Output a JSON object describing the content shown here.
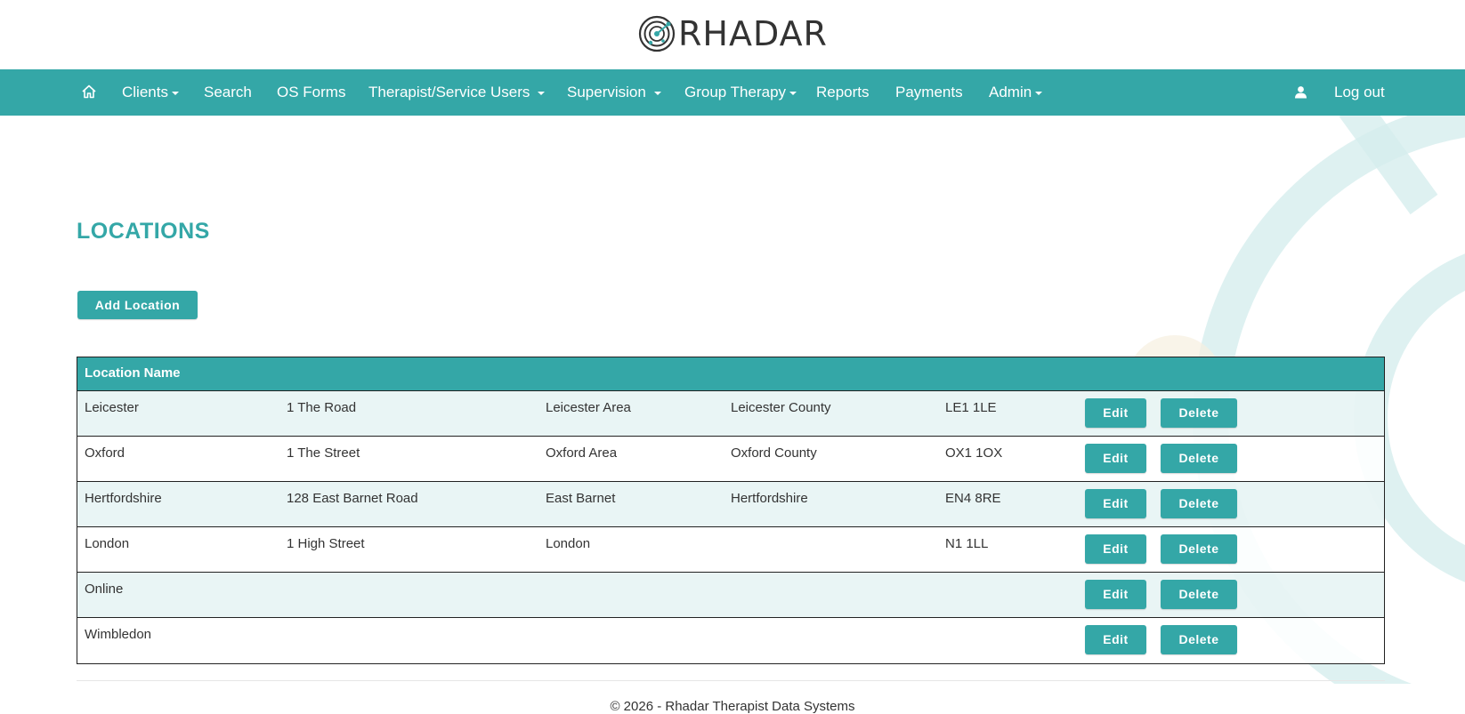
{
  "brand": {
    "name": "RHADAR",
    "logo_icon": "radar-icon"
  },
  "colors": {
    "accent": "#34a7a7",
    "row_tint": "#e7f4f4",
    "deco": "#d6eeee"
  },
  "nav": {
    "home_icon": "home-icon",
    "items": [
      {
        "label": "Clients",
        "dropdown": true
      },
      {
        "label": "Search",
        "dropdown": false
      },
      {
        "label": "OS Forms",
        "dropdown": false
      },
      {
        "label": "Therapist/Service Users",
        "dropdown": true
      },
      {
        "label": "Supervision",
        "dropdown": true
      },
      {
        "label": "Group Therapy",
        "dropdown": true
      },
      {
        "label": "Reports",
        "dropdown": false
      },
      {
        "label": "Payments",
        "dropdown": false
      },
      {
        "label": "Admin",
        "dropdown": true
      }
    ],
    "user_icon": "user-icon",
    "logout_label": "Log out"
  },
  "page": {
    "title": "LOCATIONS",
    "add_button": "Add Location"
  },
  "table": {
    "header": "Location Name",
    "edit_label": "Edit",
    "delete_label": "Delete",
    "rows": [
      {
        "name": "Leicester",
        "address": "1 The Road",
        "area": "Leicester Area",
        "county": "Leicester County",
        "postcode": "LE1 1LE"
      },
      {
        "name": "Oxford",
        "address": "1 The Street",
        "area": "Oxford Area",
        "county": "Oxford County",
        "postcode": "OX1 1OX"
      },
      {
        "name": "Hertfordshire",
        "address": "128 East Barnet Road",
        "area": "East Barnet",
        "county": "Hertfordshire",
        "postcode": "EN4 8RE"
      },
      {
        "name": "London",
        "address": "1 High Street",
        "area": "London",
        "county": "",
        "postcode": "N1 1LL"
      },
      {
        "name": "Online",
        "address": "",
        "area": "",
        "county": "",
        "postcode": ""
      },
      {
        "name": "Wimbledon",
        "address": "",
        "area": "",
        "county": "",
        "postcode": ""
      }
    ]
  },
  "footer": {
    "text": "© 2026 - Rhadar Therapist Data Systems"
  }
}
